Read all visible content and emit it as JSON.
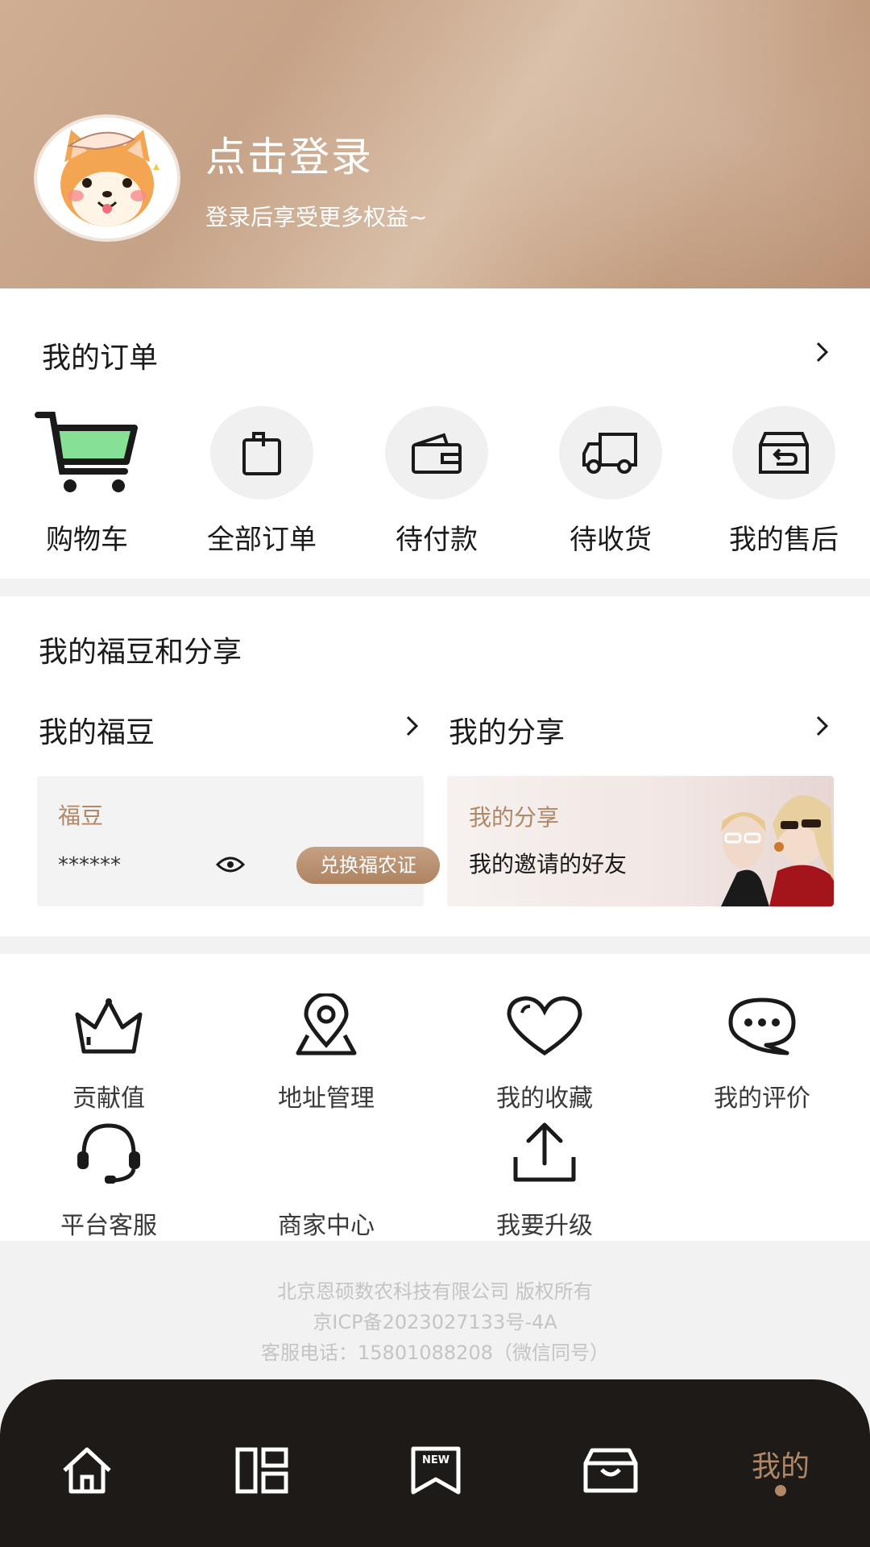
{
  "header": {
    "login_title": "点击登录",
    "login_subtitle": "登录后享受更多权益~"
  },
  "orders": {
    "title": "我的订单",
    "items": [
      {
        "label": "购物车",
        "icon": "cart-icon"
      },
      {
        "label": "全部订单",
        "icon": "shopping-bag-icon"
      },
      {
        "label": "待付款",
        "icon": "wallet-icon"
      },
      {
        "label": "待收货",
        "icon": "truck-icon"
      },
      {
        "label": "我的售后",
        "icon": "return-box-icon"
      }
    ]
  },
  "beans": {
    "title": "我的福豆和分享",
    "beans_label": "我的福豆",
    "share_label": "我的分享",
    "bean_box": {
      "title": "福豆",
      "masked_value": "******",
      "exchange_button": "兑换福农证"
    },
    "share_box": {
      "title": "我的分享",
      "subtitle": "我的邀请的好友"
    }
  },
  "tools": [
    {
      "label": "贡献值",
      "icon": "crown-icon"
    },
    {
      "label": "地址管理",
      "icon": "location-pin-icon"
    },
    {
      "label": "我的收藏",
      "icon": "heart-icon"
    },
    {
      "label": "我的评价",
      "icon": "chat-bubble-icon"
    },
    {
      "label": "平台客服",
      "icon": "headset-icon"
    },
    {
      "label": "商家中心",
      "icon": ""
    },
    {
      "label": "我要升级",
      "icon": "upload-icon"
    }
  ],
  "footer": {
    "company": "北京恩硕数农科技有限公司 版权所有",
    "icp": "京ICP备2023027133号-4A",
    "phone": "客服电话：15801088208（微信同号）"
  },
  "tabbar": {
    "items": [
      {
        "name": "home",
        "icon": "home-icon"
      },
      {
        "name": "category",
        "icon": "grid-icon"
      },
      {
        "name": "new",
        "icon": "new-bookmark-icon"
      },
      {
        "name": "shop",
        "icon": "shop-bag-icon"
      },
      {
        "name": "mine",
        "label": "我的"
      }
    ],
    "active": "mine"
  },
  "colors": {
    "accent": "#b08767",
    "tabbar_bg": "#1d1a17",
    "cart_green": "#86e096"
  }
}
